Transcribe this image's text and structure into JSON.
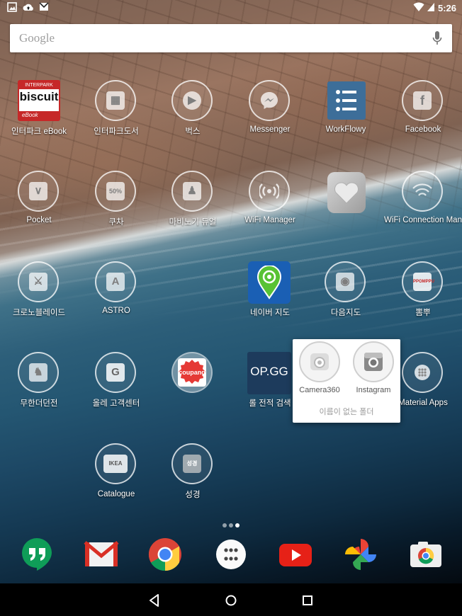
{
  "status_bar": {
    "time": "5:26",
    "left_icons": [
      "image-notification-icon",
      "cloud-upload-icon",
      "gmail-notification-icon"
    ],
    "right_icons": [
      "wifi-icon",
      "signal-icon",
      "battery-icon"
    ]
  },
  "search": {
    "placeholder": "Google"
  },
  "apps": [
    {
      "label": "인터파크 eBook",
      "icon": "biscuit-ebook-icon",
      "name": "app-interpark-ebook"
    },
    {
      "label": "인터파크도서",
      "icon": "book-icon",
      "name": "app-interpark-book"
    },
    {
      "label": "벅스",
      "icon": "play-icon",
      "name": "app-bugs"
    },
    {
      "label": "Messenger",
      "icon": "messenger-icon",
      "name": "app-messenger"
    },
    {
      "label": "WorkFlowy",
      "icon": "list-icon",
      "name": "app-workflowy"
    },
    {
      "label": "Facebook",
      "icon": "facebook-icon",
      "name": "app-facebook"
    },
    {
      "label": "Pocket",
      "icon": "pocket-icon",
      "name": "app-pocket"
    },
    {
      "label": "쿠차",
      "icon": "discount-50-icon",
      "name": "app-coocha"
    },
    {
      "label": "마비노기 듀얼",
      "icon": "game-character-icon",
      "name": "app-mabinogi-duel"
    },
    {
      "label": "WiFi Manager",
      "icon": "wifi-signal-icon",
      "name": "app-wifi-manager"
    },
    {
      "label": "",
      "icon": "heart-tiles-icon",
      "name": "app-heart-game"
    },
    {
      "label": "WiFi Connection Man",
      "icon": "wifi-connection-icon",
      "name": "app-wifi-connection-manager"
    },
    {
      "label": "크로노블레이드",
      "icon": "blade-character-icon",
      "name": "app-chronoblade"
    },
    {
      "label": "ASTRO",
      "icon": "astro-icon",
      "name": "app-astro"
    },
    {
      "label": "네이버 지도",
      "icon": "map-pin-icon",
      "name": "app-naver-map"
    },
    {
      "label": "다음지도",
      "icon": "location-icon",
      "name": "app-daum-map"
    },
    {
      "label": "뽐뿌",
      "icon": "ppomppu-icon",
      "name": "app-ppomppu"
    },
    {
      "label": "무한더던전",
      "icon": "dungeon-character-icon",
      "name": "app-infinite-dungeon"
    },
    {
      "label": "올레 고객센터",
      "icon": "olleh-icon",
      "name": "app-olleh-customer-center"
    },
    {
      "label": "",
      "icon": "coupang-icon",
      "name": "app-coupang"
    },
    {
      "label": "롤 전적 검색",
      "icon": "opgg-icon",
      "name": "app-opgg"
    },
    {
      "label": "Material Apps",
      "icon": "material-apps-icon",
      "name": "app-material-apps"
    },
    {
      "label": "Catalogue",
      "icon": "ikea-catalogue-icon",
      "name": "app-catalogue"
    },
    {
      "label": "성경",
      "icon": "bible-icon",
      "name": "app-bible"
    }
  ],
  "icon_texts": {
    "biscuit_top": "INTERPARK",
    "biscuit_main": "biscuit",
    "biscuit_bottom": "eBook",
    "coocha": "50%",
    "opgg": "OP.GG",
    "coupang": "coupang",
    "ppomppu": "PPOMPPU",
    "ikea": "IKEA",
    "bible": "성경"
  },
  "folder": {
    "name": "이름이 없는 폴더",
    "apps": [
      {
        "label": "Camera360",
        "icon": "camera360-icon"
      },
      {
        "label": "Instagram",
        "icon": "instagram-icon"
      }
    ]
  },
  "page_indicator": {
    "pages": 2,
    "current": 2
  },
  "dock": [
    {
      "name": "hangouts",
      "icon": "hangouts-icon"
    },
    {
      "name": "gmail",
      "icon": "gmail-icon"
    },
    {
      "name": "chrome",
      "icon": "chrome-icon"
    },
    {
      "name": "all-apps",
      "icon": "app-drawer-icon"
    },
    {
      "name": "youtube",
      "icon": "youtube-icon"
    },
    {
      "name": "photos",
      "icon": "photos-icon"
    },
    {
      "name": "camera",
      "icon": "camera-icon"
    }
  ],
  "navigation": [
    "back-icon",
    "home-icon",
    "recents-icon"
  ],
  "colors": {
    "accent_red": "#e53935",
    "hangouts_green": "#0f9d58",
    "youtube_red": "#e62117",
    "naver_green": "#58c234",
    "workflowy_blue": "#3d6e99"
  }
}
